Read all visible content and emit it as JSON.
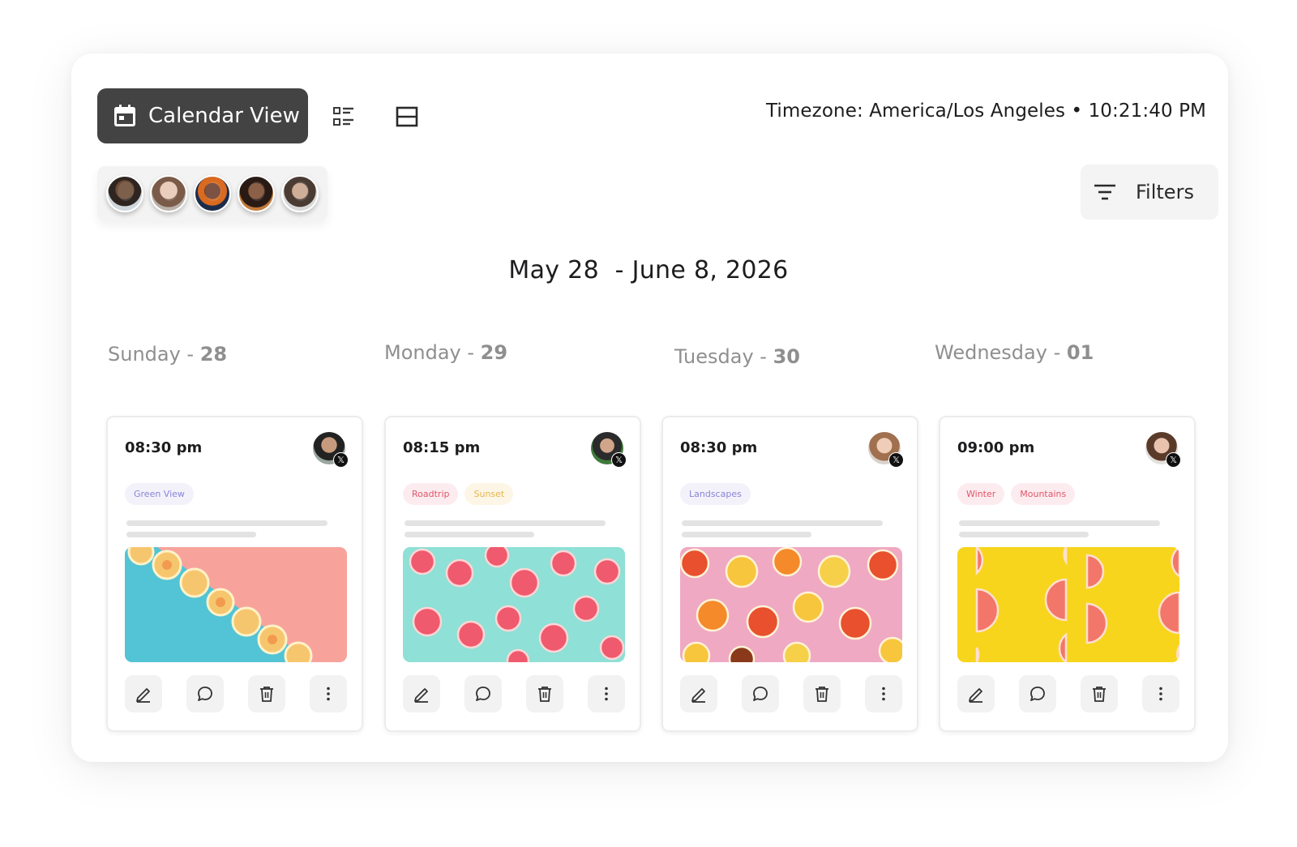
{
  "toolbar": {
    "calendar_view_label": "Calendar View",
    "timezone_text": "Timezone: America/Los Angeles • 10:21:40 PM"
  },
  "filters": {
    "label": "Filters"
  },
  "date_range": "May 28  - June 8, 2026",
  "days": [
    {
      "name": "Sunday - ",
      "num": "28"
    },
    {
      "name": "Monday - ",
      "num": "29"
    },
    {
      "name": "Tuesday - ",
      "num": "30"
    },
    {
      "name": "Wednesday - ",
      "num": "01"
    }
  ],
  "posts": [
    {
      "time": "08:30 pm",
      "tags": [
        "Green View"
      ],
      "network_badge": "𝕏"
    },
    {
      "time": "08:15 pm",
      "tags": [
        "Roadtrip",
        "Sunset"
      ],
      "network_badge": "𝕏"
    },
    {
      "time": "08:30 pm",
      "tags": [
        "Landscapes"
      ],
      "network_badge": "𝕏"
    },
    {
      "time": "09:00 pm",
      "tags": [
        "Winter",
        "Mountains"
      ],
      "network_badge": "𝕏"
    }
  ],
  "colors": {
    "primary_button": "#434343",
    "tag_green_view": "#8a84d6",
    "tag_roadtrip": "#e0566b",
    "tag_sunset": "#e8b54a",
    "tag_landscapes": "#8a84d6",
    "tag_winter": "#e0566b",
    "tag_mountains": "#e0566b"
  },
  "icons": {
    "calendar": "calendar-icon",
    "list_view": "list-view-icon",
    "split_view": "split-view-icon",
    "filter": "filter-icon",
    "edit": "pencil-icon",
    "comment": "comment-icon",
    "delete": "trash-icon",
    "more": "more-vertical-icon",
    "network": "x-logo-icon"
  }
}
